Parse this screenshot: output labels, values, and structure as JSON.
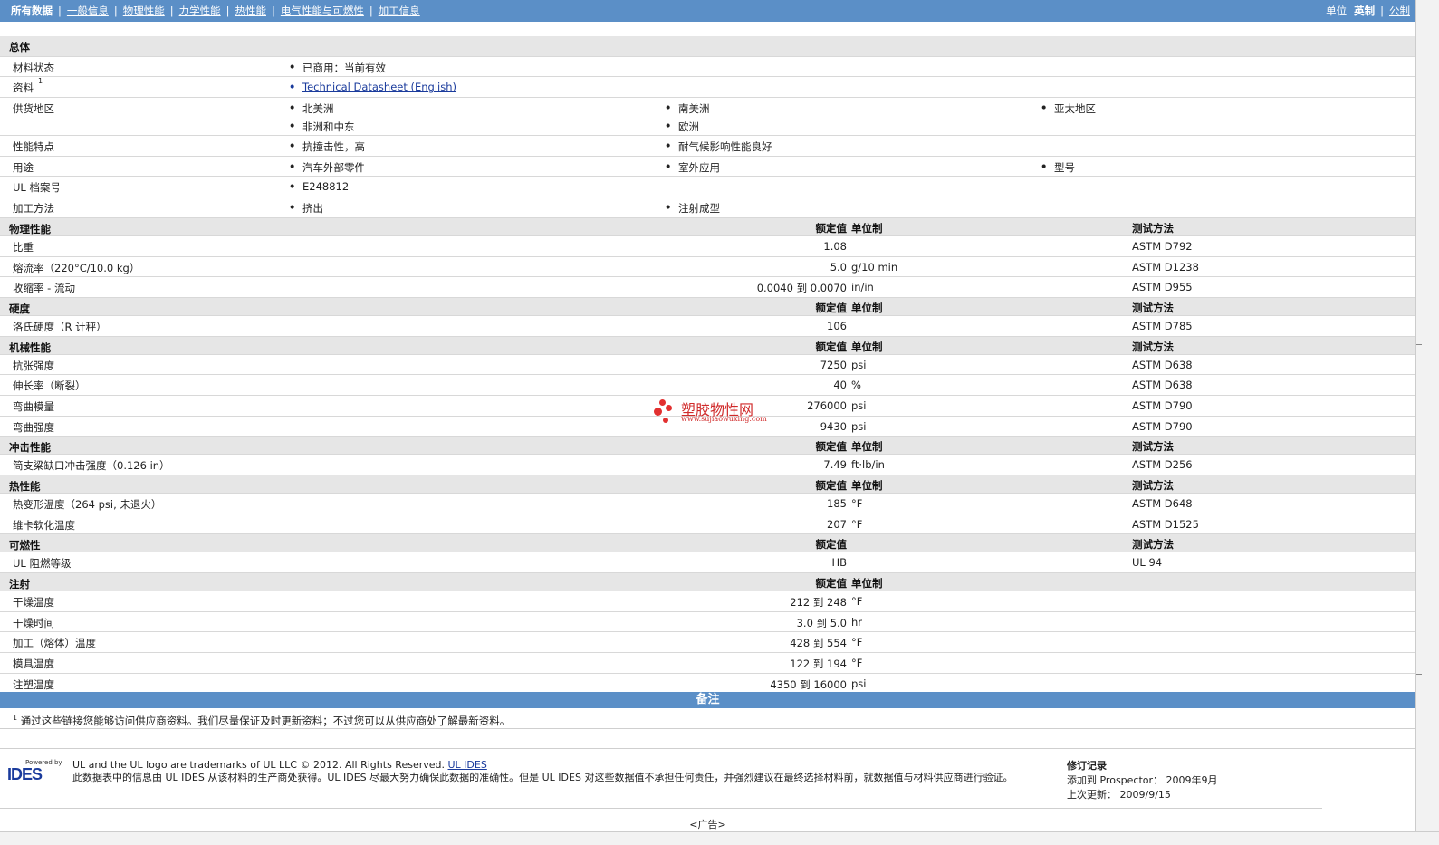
{
  "nav": {
    "tabs": [
      "所有数据",
      "一般信息",
      "物理性能",
      "力学性能",
      "热性能",
      "电气性能与可燃性",
      "加工信息"
    ],
    "units_label": "单位",
    "units_current": "英制",
    "units_other": "公制"
  },
  "general": {
    "title": "总体",
    "rows": [
      {
        "label": "材料状态",
        "items": [
          "已商用：当前有效"
        ]
      },
      {
        "label": "资料",
        "sup": "1",
        "items": [
          "Technical Datasheet (English)"
        ]
      },
      {
        "label": "供货地区",
        "items": [
          "北美洲",
          "南美洲",
          "亚太地区",
          "非洲和中东",
          "欧洲"
        ]
      },
      {
        "label": "性能特点",
        "items": [
          "抗撞击性，高",
          "耐气候影响性能良好"
        ]
      },
      {
        "label": "用途",
        "items": [
          "汽车外部零件",
          "室外应用",
          "型号"
        ]
      },
      {
        "label": "UL 档案号",
        "items": [
          "E248812"
        ]
      },
      {
        "label": "加工方法",
        "items": [
          "挤出",
          "注射成型"
        ]
      }
    ]
  },
  "columns": {
    "value": "额定值",
    "unit": "单位制",
    "method": "测试方法"
  },
  "sections": [
    {
      "title": "物理性能",
      "rows": [
        {
          "label": "比重",
          "value": "1.08",
          "unit": "",
          "method": "ASTM D792"
        },
        {
          "label": "熔流率（220°C/10.0 kg）",
          "value": "5.0",
          "unit": "g/10 min",
          "method": "ASTM D1238"
        },
        {
          "label": "收缩率 - 流动",
          "value": "0.0040 到 0.0070",
          "unit": "in/in",
          "method": "ASTM D955"
        }
      ]
    },
    {
      "title": "硬度",
      "rows": [
        {
          "label": "洛氏硬度（R 计秤）",
          "value": "106",
          "unit": "",
          "method": "ASTM D785"
        }
      ]
    },
    {
      "title": "机械性能",
      "rows": [
        {
          "label": "抗张强度",
          "value": "7250",
          "unit": "psi",
          "method": "ASTM D638"
        },
        {
          "label": "伸长率（断裂）",
          "value": "40",
          "unit": "%",
          "method": "ASTM D638"
        },
        {
          "label": "弯曲模量",
          "value": "276000",
          "unit": "psi",
          "method": "ASTM D790"
        },
        {
          "label": "弯曲强度",
          "value": "9430",
          "unit": "psi",
          "method": "ASTM D790"
        }
      ]
    },
    {
      "title": "冲击性能",
      "rows": [
        {
          "label": "简支梁缺口冲击强度（0.126 in）",
          "value": "7.49",
          "unit": "ft·lb/in",
          "method": "ASTM D256"
        }
      ]
    },
    {
      "title": "热性能",
      "rows": [
        {
          "label": "热变形温度（264 psi, 未退火）",
          "value": "185",
          "unit": "°F",
          "method": "ASTM D648"
        },
        {
          "label": "维卡软化温度",
          "value": "207",
          "unit": "°F",
          "method": "ASTM D1525"
        }
      ]
    },
    {
      "title": "可燃性",
      "no_unit": true,
      "rows": [
        {
          "label": "UL 阻燃等级",
          "value": "HB",
          "unit": "",
          "method": "UL 94"
        }
      ]
    },
    {
      "title": "注射",
      "no_method": true,
      "rows": [
        {
          "label": "干燥温度",
          "value": "212 到 248",
          "unit": "°F",
          "method": ""
        },
        {
          "label": "干燥时间",
          "value": "3.0 到 5.0",
          "unit": "hr",
          "method": ""
        },
        {
          "label": "加工（熔体）温度",
          "value": "428 到 554",
          "unit": "°F",
          "method": ""
        },
        {
          "label": "模具温度",
          "value": "122 到 194",
          "unit": "°F",
          "method": ""
        },
        {
          "label": "注塑温度",
          "value": "4350 到 16000",
          "unit": "psi",
          "method": ""
        }
      ]
    }
  ],
  "notes": {
    "title": "备注",
    "sup": "1",
    "text": "通过这些链接您能够访问供应商资料。我们尽量保证及时更新资料；不过您可以从供应商处了解最新资料。"
  },
  "footer": {
    "logo_powered": "Powered by",
    "logo_text": "IDES",
    "trademark": "UL and the UL logo are trademarks of UL LLC © 2012. All Rights Reserved.",
    "trademark_link": "UL IDES",
    "disclaimer": "此数据表中的信息由 UL IDES 从该材料的生产商处获得。UL IDES 尽最大努力确保此数据的准确性。但是 UL IDES 对这些数据值不承担任何责任，并强烈建议在最终选择材料前，就数据值与材料供应商进行验证。",
    "revision_title": "修订记录",
    "added": "添加到 Prospector：  2009年9月",
    "updated": "上次更新：  2009/9/15"
  },
  "ad": "<广告>",
  "watermark": {
    "cn": "塑胶物性网",
    "en": "www.sujiaowuxing.com"
  }
}
